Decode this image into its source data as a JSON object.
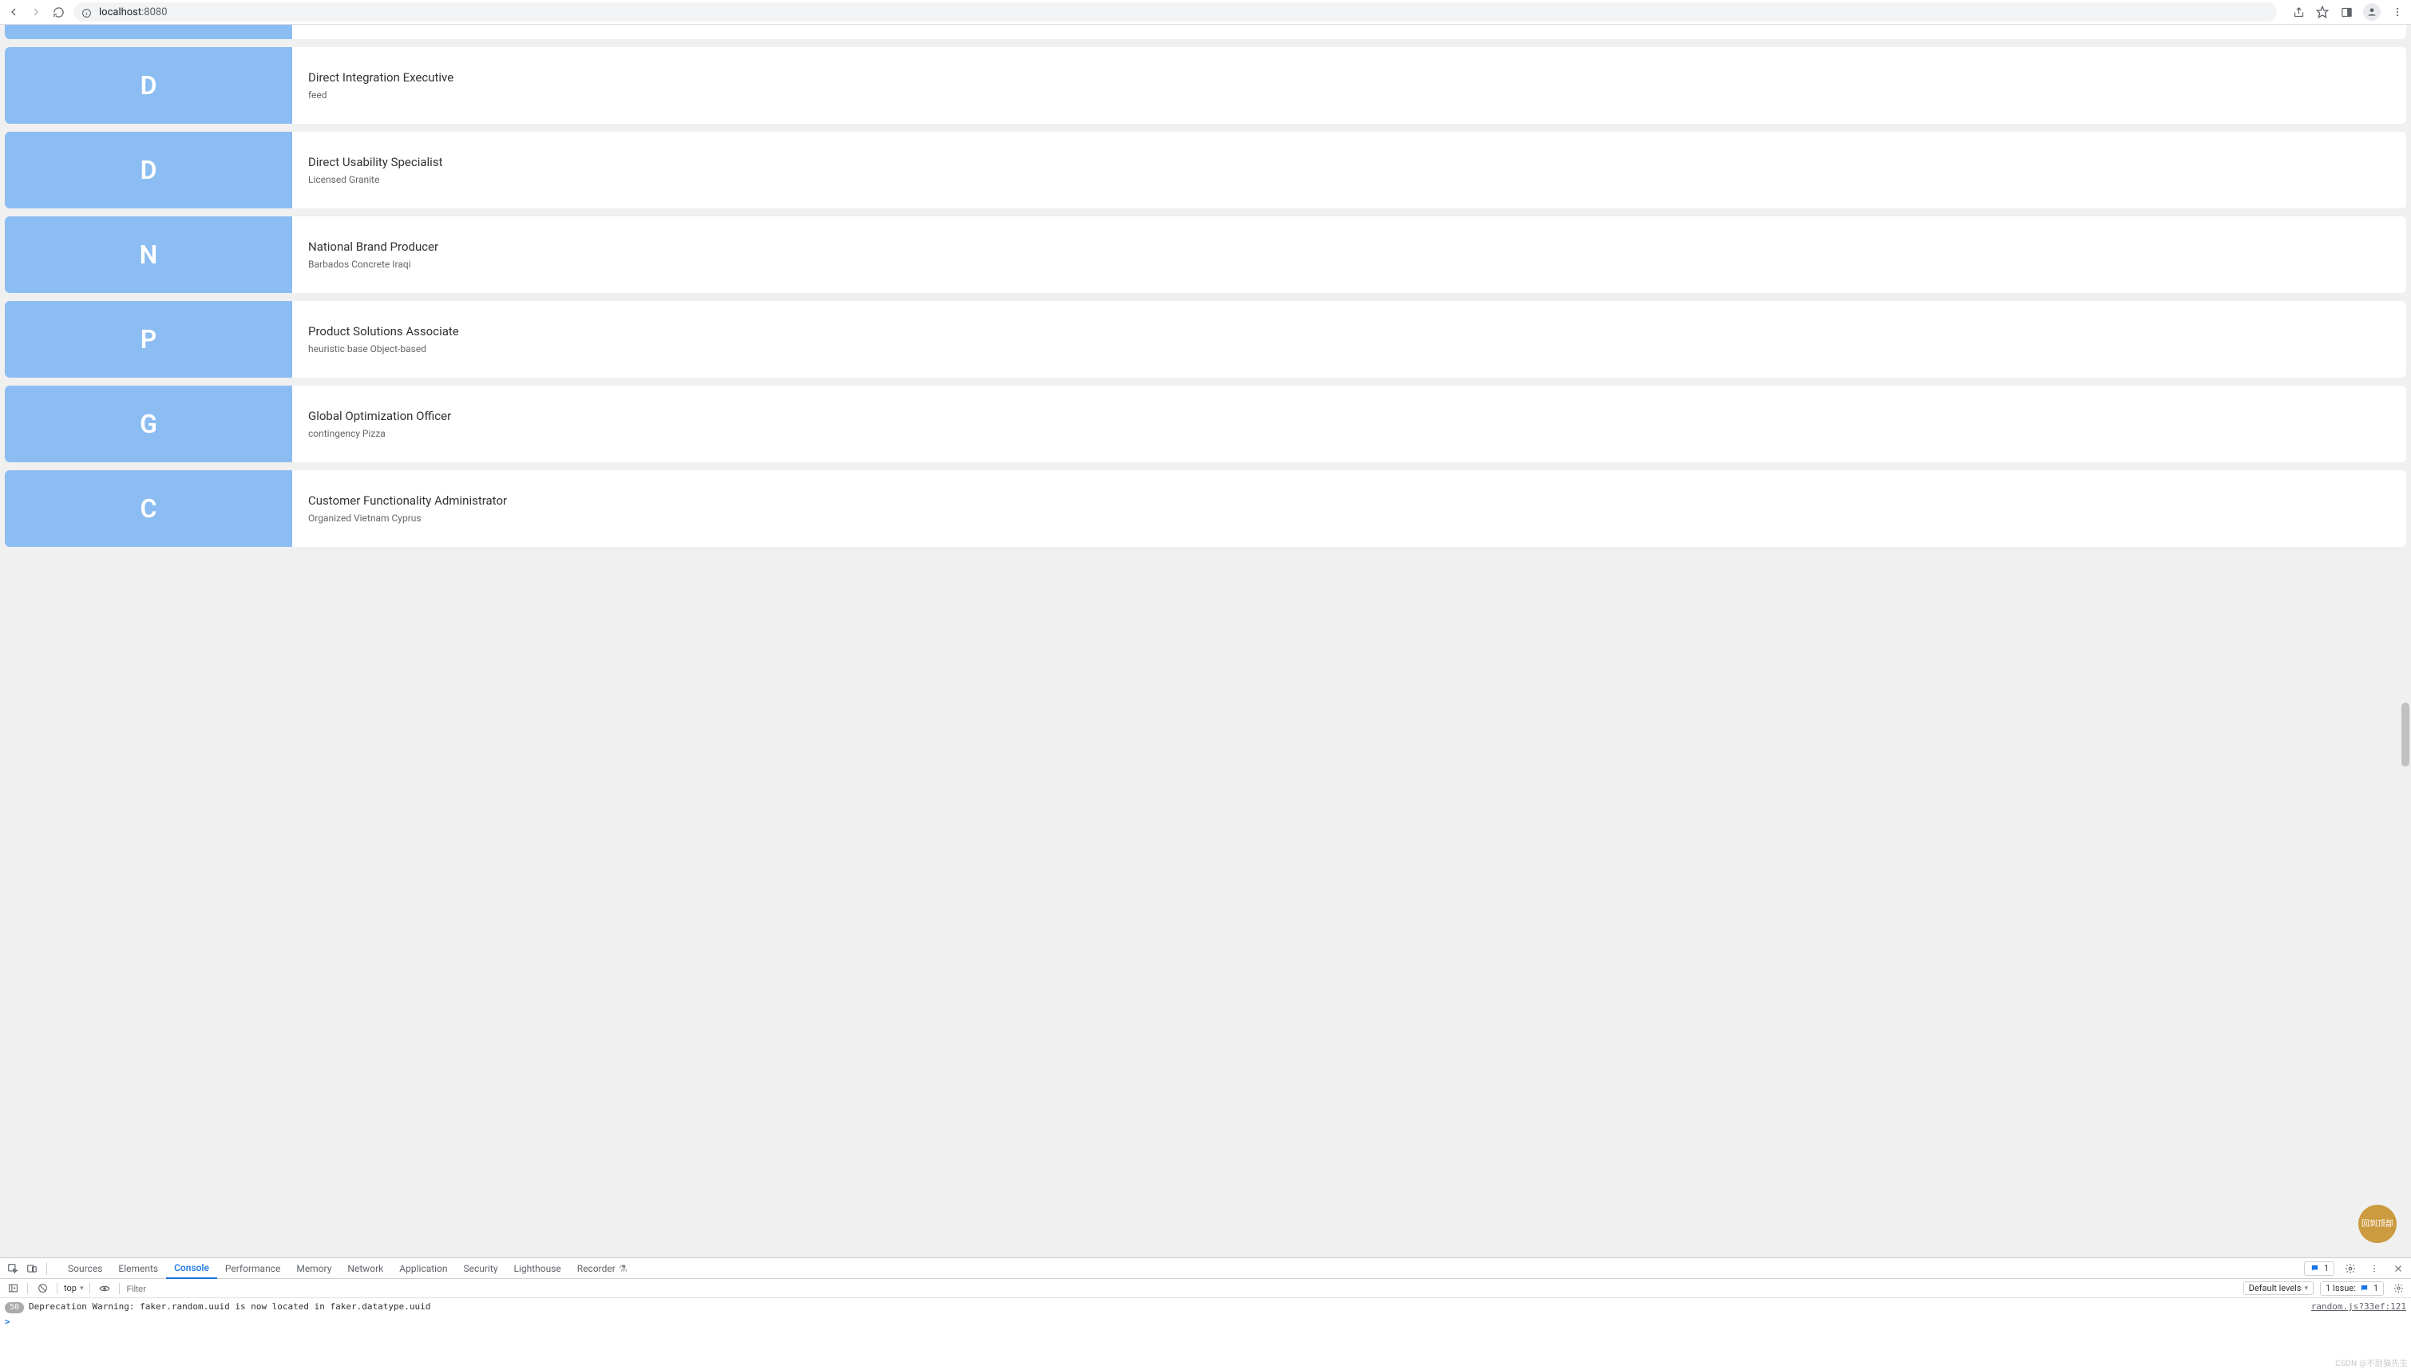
{
  "browser": {
    "url_host": "localhost",
    "url_port": ":8080"
  },
  "scroll_top_label": "回到顶部",
  "cards": [
    {
      "letter": "",
      "title": "",
      "sub": ""
    },
    {
      "letter": "D",
      "title": "Direct Integration Executive",
      "sub": "feed"
    },
    {
      "letter": "D",
      "title": "Direct Usability Specialist",
      "sub": "Licensed Granite"
    },
    {
      "letter": "N",
      "title": "National Brand Producer",
      "sub": "Barbados Concrete Iraqi"
    },
    {
      "letter": "P",
      "title": "Product Solutions Associate",
      "sub": "heuristic base Object-based"
    },
    {
      "letter": "G",
      "title": "Global Optimization Officer",
      "sub": "contingency Pizza"
    },
    {
      "letter": "C",
      "title": "Customer Functionality Administrator",
      "sub": "Organized Vietnam Cyprus"
    }
  ],
  "devtools": {
    "tabs": {
      "sources": "Sources",
      "elements": "Elements",
      "console": "Console",
      "performance": "Performance",
      "memory": "Memory",
      "network": "Network",
      "application": "Application",
      "security": "Security",
      "lighthouse": "Lighthouse",
      "recorder": "Recorder"
    },
    "msg_badge": "1",
    "toolbar": {
      "context": "top",
      "filter_placeholder": "Filter",
      "levels": "Default levels",
      "issues_label": "1 Issue:",
      "issues_count": "1"
    },
    "console": {
      "count": "50",
      "message": "Deprecation Warning: faker.random.uuid is now located in faker.datatype.uuid",
      "link": "random.js?33ef:121",
      "prompt": ">"
    }
  },
  "watermark": "CSDN @不刮猫先生"
}
